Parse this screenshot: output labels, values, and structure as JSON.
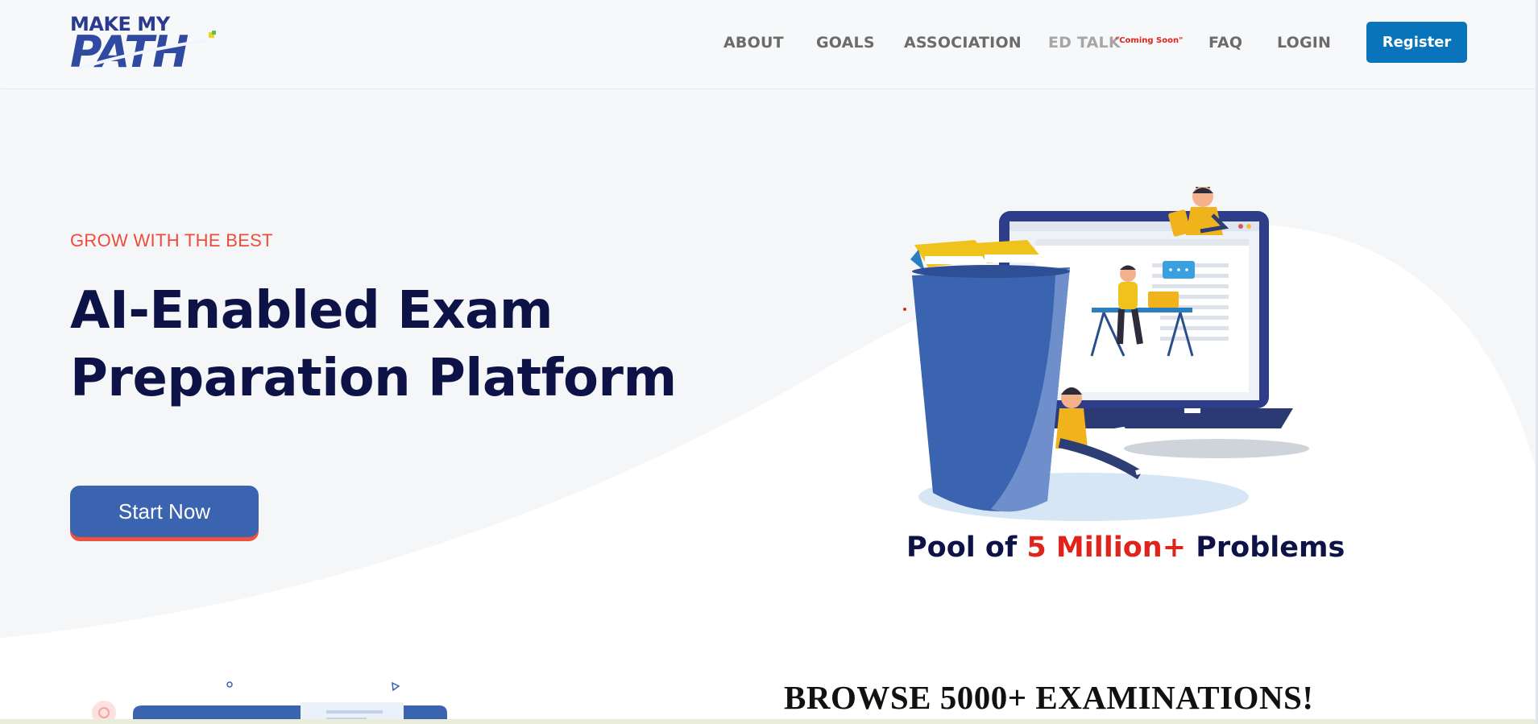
{
  "header": {
    "logo": {
      "line1": "MAKE MY",
      "line2": "PATH"
    },
    "nav": [
      {
        "label": "ABOUT"
      },
      {
        "label": "GOALS"
      },
      {
        "label": "ASSOCIATION"
      },
      {
        "label": "ED TALK",
        "badge": "\"Coming Soon\""
      },
      {
        "label": "FAQ"
      },
      {
        "label": "LOGIN"
      }
    ],
    "register_label": "Register"
  },
  "hero": {
    "kicker": "GROW WITH THE BEST",
    "headline_line1": "AI-Enabled Exam",
    "headline_line2": "Preparation Platform",
    "cta_label": "Start Now",
    "pool_prefix": "Pool of ",
    "pool_highlight": "5 Million+",
    "pool_suffix": " Problems"
  },
  "browse": {
    "title": "BROWSE 5000+ EXAMINATIONS!"
  },
  "colors": {
    "navy": "#0e1347",
    "accent_red": "#ef4b3a",
    "register_blue": "#0a74bb",
    "cta_blue": "#3a63b0"
  }
}
